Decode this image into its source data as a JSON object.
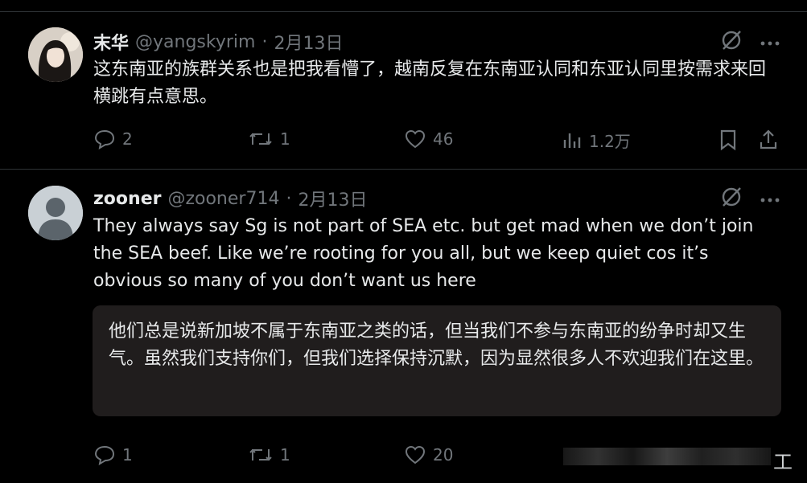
{
  "tweets": [
    {
      "name": "末华",
      "handle": "@yangskyrim",
      "sep": "·",
      "date": "2月13日",
      "text": "这东南亚的族群关系也是把我看懵了，越南反复在东南亚认同和东亚认同里按需求来回横跳有点意思。",
      "replies": "2",
      "retweets": "1",
      "likes": "46",
      "views": "1.2万"
    },
    {
      "name": "zooner",
      "handle": "@zooner714",
      "sep": "·",
      "date": "2月13日",
      "text": "They always say Sg is not part of SEA etc. but get mad when we don’t join the SEA beef. Like we’re rooting for you all, but we keep quiet cos it’s obvious so many of you don’t want us here",
      "translation": "他们总是说新加坡不属于东南亚之类的话，但当我们不参与东南亚的纷争时却又生气。虽然我们支持你们，但我们选择保持沉默，因为显然很多人不欢迎我们在这里。",
      "replies": "1",
      "retweets": "1",
      "likes": "20"
    }
  ],
  "watermark": "工",
  "colors": {
    "background": "#000000",
    "text": "#e7e9ea",
    "muted": "#71767b",
    "border": "#2f3336",
    "translation_bg": "#201d1d"
  },
  "icons": [
    "grok-icon",
    "more-icon",
    "reply-icon",
    "retweet-icon",
    "like-icon",
    "views-icon",
    "bookmark-icon",
    "share-icon"
  ]
}
